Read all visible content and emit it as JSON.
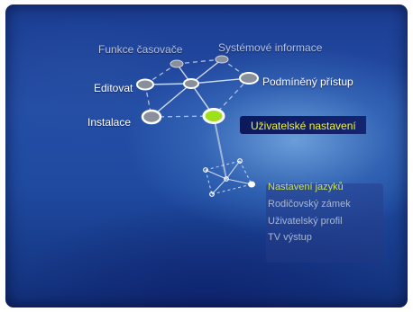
{
  "colors": {
    "highlight_text": "#f2f239",
    "active_submenu_text": "#c9e05c",
    "selected_node": "#9ee01c",
    "background": "#1f4aa0"
  },
  "menu": {
    "items": [
      {
        "label": "Funkce časovače",
        "state": "dim"
      },
      {
        "label": "Systémové informace",
        "state": "dim"
      },
      {
        "label": "Editovat",
        "state": "normal"
      },
      {
        "label": "Podmíněný přístup",
        "state": "normal"
      },
      {
        "label": "Instalace",
        "state": "normal"
      },
      {
        "label": "Uživatelské nastavení",
        "state": "selected"
      }
    ]
  },
  "submenu": {
    "items": [
      {
        "label": "Nastavení jazyků",
        "state": "active"
      },
      {
        "label": "Rodičovský zámek",
        "state": "normal"
      },
      {
        "label": "Uživatelský profil",
        "state": "normal"
      },
      {
        "label": "TV výstup",
        "state": "normal"
      }
    ]
  }
}
